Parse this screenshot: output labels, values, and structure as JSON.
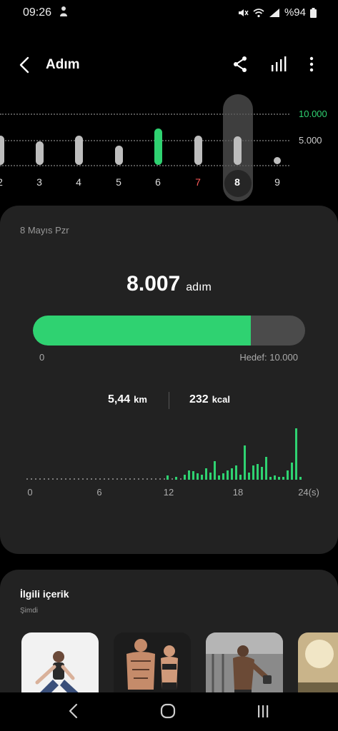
{
  "status_bar": {
    "time": "09:26",
    "battery": "%94",
    "icons": [
      "person-emoji-icon",
      "mute-icon",
      "wifi-icon",
      "signal-icon",
      "battery-icon"
    ]
  },
  "app_bar": {
    "title": "Adım",
    "icons": [
      "back-arrow-icon",
      "share-icon",
      "bar-chart-icon",
      "more-vert-icon"
    ]
  },
  "day_strip": {
    "goal_labels": [
      "10.000",
      "5.000"
    ],
    "days": [
      {
        "label": "2",
        "level": 0.45,
        "color": "gray"
      },
      {
        "label": "3",
        "level": 0.37,
        "color": "gray"
      },
      {
        "label": "4",
        "level": 0.45,
        "color": "gray"
      },
      {
        "label": "5",
        "level": 0.3,
        "color": "gray"
      },
      {
        "label": "6",
        "level": 0.57,
        "color": "green"
      },
      {
        "label": "7",
        "level": 0.46,
        "color": "gray",
        "label_color": "red"
      },
      {
        "label": "8",
        "level": 0.44,
        "color": "gray",
        "selected": true
      },
      {
        "label": "9",
        "level": 0.0,
        "color": "gray"
      }
    ]
  },
  "summary": {
    "date": "8 Mayıs Pzr",
    "steps": "8.007",
    "steps_unit": "adım",
    "progress_fraction": 0.8007,
    "progress_min": "0",
    "goal_text": "Hedef: 10.000",
    "distance": "5,44",
    "distance_unit": "km",
    "calories": "232",
    "calories_unit": "kcal"
  },
  "hourly": {
    "axis_labels": [
      "0",
      "6",
      "12",
      "18",
      "24(s)"
    ],
    "bars": [
      0,
      0,
      0,
      0,
      0,
      0,
      0,
      0,
      0,
      0,
      0,
      0,
      0,
      0,
      0,
      0,
      0,
      0,
      0,
      0,
      0,
      0,
      0,
      0,
      0,
      0,
      0,
      0,
      0,
      0,
      0,
      0,
      0,
      0.08,
      0,
      0.06,
      0,
      0.1,
      0.18,
      0.17,
      0.12,
      0.1,
      0.22,
      0.14,
      0.36,
      0.08,
      0.12,
      0.18,
      0.22,
      0.28,
      0.1,
      0.66,
      0.14,
      0.28,
      0.3,
      0.25,
      0.44,
      0.05,
      0.08,
      0.05,
      0.06,
      0.18,
      0.34,
      1.0,
      0.05
    ]
  },
  "related": {
    "title": "İlgili içerik",
    "subtitle": "Şimdi",
    "thumbnails": [
      "yoga-woman-photo",
      "fitness-couple-photo",
      "gym-man-photo",
      "outdoor-photo"
    ]
  },
  "nav_bar": {
    "icons": [
      "nav-back-icon",
      "nav-home-icon",
      "nav-recent-icon"
    ]
  },
  "colors": {
    "accent_green": "#2fd271",
    "card_bg": "#222222",
    "red": "#ff5a5a"
  }
}
